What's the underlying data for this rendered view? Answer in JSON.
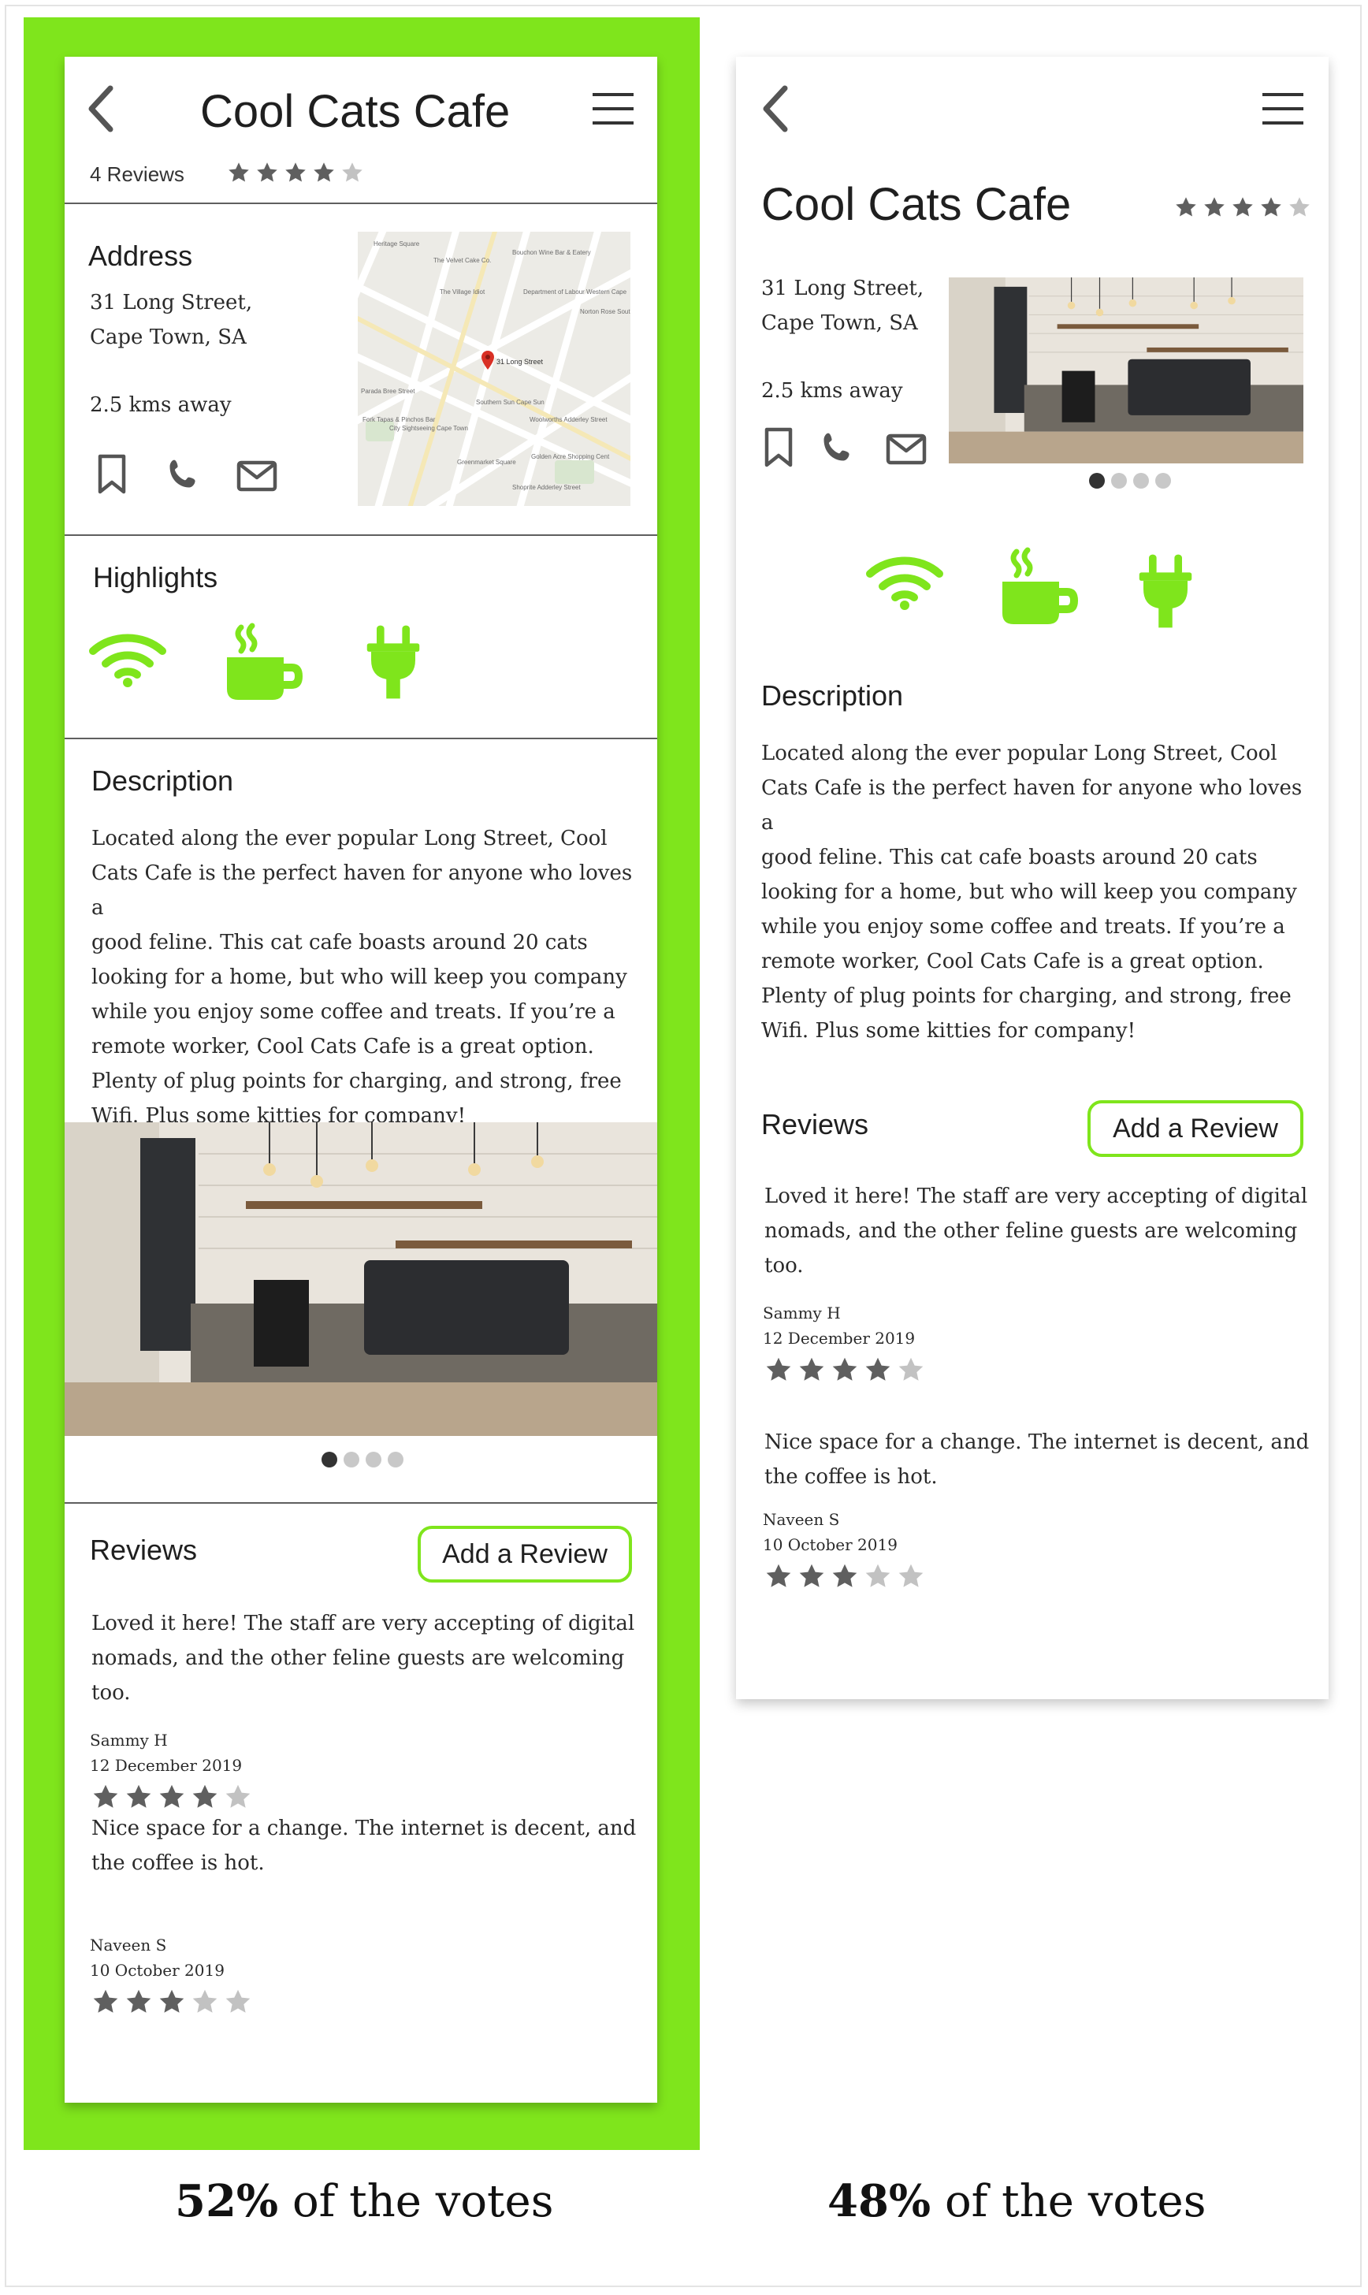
{
  "colors": {
    "accent": "#7fe51c",
    "star_filled": "#5f5f5f",
    "star_empty": "#c2c2c2",
    "divider": "#5f5f5f"
  },
  "icons": [
    "back-arrow-icon",
    "hamburger-menu-icon",
    "bookmark-icon",
    "phone-icon",
    "mail-icon",
    "wifi-icon",
    "coffee-cup-icon",
    "plug-icon",
    "star-icon"
  ],
  "variant_a": {
    "header": {
      "title": "Cool Cats Cafe"
    },
    "rating": {
      "reviews_count": "4 Reviews",
      "stars": 4
    },
    "address": {
      "heading": "Address",
      "line1": "31 Long Street,",
      "line2": "Cape Town, SA",
      "distance": "2.5 kms away"
    },
    "map": {
      "pin_label": "31 Long Street",
      "labels": [
        "Heritage Square",
        "The Velvet Cake Co.",
        "Bouchon Wine Bar & Eatery",
        "The Village Idiot",
        "Department of Labour Western Cape",
        "Norton Rose South Af",
        "Parada Bree Street",
        "Southern Sun Cape Sun",
        "Fork Tapas & Pinchos Bar",
        "City Sightseeing Cape Town",
        "Woolworths Adderley Street",
        "Greenmarket Square",
        "Golden Acre Shopping Cent",
        "Shoprite Adderley Street"
      ]
    },
    "highlights": {
      "heading": "Highlights"
    },
    "description": {
      "heading": "Description",
      "lines": [
        "Located along the ever popular Long Street, Cool",
        "Cats Cafe is the perfect haven for anyone who loves a",
        "good feline. This cat cafe boasts around 20 cats",
        "looking for a home, but who will keep you company",
        "while you enjoy some coffee and treats. If you’re a",
        "remote worker, Cool Cats Cafe is a great option.",
        "Plenty of plug points for charging, and strong, free",
        "Wifi. Plus some kitties for company!"
      ]
    },
    "carousel": {
      "count": 4,
      "active": 0
    },
    "reviews": {
      "heading": "Reviews",
      "add_button": "Add a Review",
      "items": [
        {
          "lines": [
            "Loved it here! The staff are very accepting of digital",
            "nomads, and the other feline guests are welcoming",
            "too."
          ],
          "author": "Sammy H",
          "date": "12 December 2019",
          "stars": 4
        },
        {
          "lines": [
            "Nice space for a change. The internet is decent, and",
            "the coffee is hot."
          ],
          "author": "Naveen S",
          "date": "10 October 2019",
          "stars": 3
        }
      ]
    },
    "votes": {
      "percent": "52%",
      "suffix": " of the votes"
    }
  },
  "variant_b": {
    "header": {
      "title": "Cool Cats Cafe"
    },
    "rating": {
      "stars": 4
    },
    "address": {
      "line1": "31 Long Street,",
      "line2": "Cape Town, SA",
      "distance": "2.5 kms away"
    },
    "carousel": {
      "count": 4,
      "active": 0
    },
    "description": {
      "heading": "Description",
      "lines": [
        "Located along the ever popular Long Street, Cool",
        "Cats Cafe is the perfect haven for anyone who loves a",
        "good feline. This cat cafe boasts around 20 cats",
        "looking for a home, but who will keep you company",
        "while you enjoy some coffee and treats. If you’re a",
        "remote worker, Cool Cats Cafe is a great option.",
        "Plenty of plug points for charging, and strong, free",
        "Wifi. Plus some kitties for company!"
      ]
    },
    "reviews": {
      "heading": "Reviews",
      "add_button": "Add a Review",
      "items": [
        {
          "lines": [
            "Loved it here! The staff are very accepting of digital",
            "nomads, and the other feline guests are welcoming",
            "too."
          ],
          "author": "Sammy H",
          "date": "12 December 2019",
          "stars": 4
        },
        {
          "lines": [
            "Nice space for a change. The internet is decent, and",
            "the coffee is hot."
          ],
          "author": "Naveen S",
          "date": "10 October 2019",
          "stars": 3
        }
      ]
    },
    "votes": {
      "percent": "48%",
      "suffix": " of the votes"
    }
  }
}
